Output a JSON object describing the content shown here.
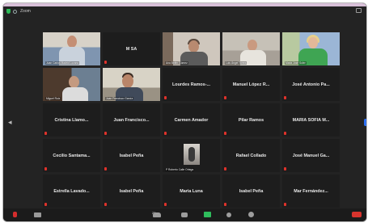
{
  "topbar": {
    "title": "Zoom"
  },
  "tiles": [
    {
      "name": "",
      "video": true,
      "scene": "v1",
      "caption": "Juan Carlos Madrid Lozano",
      "mic_muted": false
    },
    {
      "name": "M SA",
      "video": false,
      "mic_muted": false
    },
    {
      "name": "",
      "video": true,
      "scene": "v3",
      "caption": "Ana Belén Gómez",
      "mic_muted": false
    },
    {
      "name": "",
      "video": true,
      "scene": "v4",
      "caption": "Luis Ángel Torres",
      "mic_muted": false
    },
    {
      "name": "",
      "video": true,
      "scene": "v5",
      "caption": "Maria José Soler",
      "mic_muted": false
    },
    {
      "name": "",
      "video": true,
      "scene": "v6",
      "caption": "Miguel Ruiz",
      "mic_muted": false
    },
    {
      "name": "",
      "video": true,
      "scene": "v7",
      "caption": "Juan Francisco García",
      "speaking": true,
      "mic_muted": false
    },
    {
      "name": "Lourdes Ramos-...",
      "video": false,
      "mic_muted": true
    },
    {
      "name": "Manuel López R...",
      "video": false,
      "mic_muted": true
    },
    {
      "name": "José Antonio Pa...",
      "video": false,
      "mic_muted": true
    },
    {
      "name": "Cristina Llamo...",
      "video": false,
      "mic_muted": true
    },
    {
      "name": "Juan Francisco...",
      "video": false,
      "mic_muted": true
    },
    {
      "name": "Carmen Amador",
      "video": false,
      "mic_muted": true
    },
    {
      "name": "Pilar Ramos",
      "video": false,
      "mic_muted": true
    },
    {
      "name": "MARIA SOFIA M...",
      "video": false,
      "mic_muted": true
    },
    {
      "name": "Cecilio Santama...",
      "video": false,
      "mic_muted": true
    },
    {
      "name": "Isabel Peña",
      "video": false,
      "mic_muted": true
    },
    {
      "name": "",
      "video": true,
      "scene": "v8",
      "caption": "P Roberto Calle Ortega",
      "mic_muted": false
    },
    {
      "name": "Rafael Collado",
      "video": false,
      "mic_muted": true
    },
    {
      "name": "José Manuel Ga...",
      "video": false,
      "mic_muted": true
    },
    {
      "name": "Estrella Lavado...",
      "video": false,
      "mic_muted": true
    },
    {
      "name": "Isabel Peña",
      "video": false,
      "mic_muted": true
    },
    {
      "name": "Maria Luna",
      "video": false,
      "mic_muted": true
    },
    {
      "name": "Isabel Peña",
      "video": false,
      "mic_muted": true
    },
    {
      "name": "Mar Fernández...",
      "video": false,
      "mic_muted": true
    }
  ],
  "toolbar": {
    "participants_count": "25"
  }
}
